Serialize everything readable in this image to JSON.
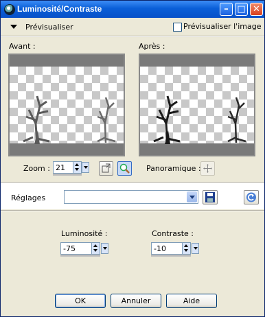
{
  "window": {
    "title": "Luminosité/Contraste",
    "controls": {
      "minimize": "–",
      "maximize": "□",
      "close": "✕"
    }
  },
  "preview_bar": {
    "label": "Prévisualiser",
    "preview_image_label": "Prévisualiser l'image",
    "preview_image_checked": false
  },
  "before_label": "Avant :",
  "after_label": "Après :",
  "zoom": {
    "label": "Zoom :",
    "value": "21"
  },
  "pan_label": "Panoramique :",
  "presets": {
    "label": "Réglages",
    "value": ""
  },
  "brightness": {
    "label": "Luminosité :",
    "value": "-75"
  },
  "contrast": {
    "label": "Contraste :",
    "value": "-10"
  },
  "buttons": {
    "ok": "OK",
    "cancel": "Annuler",
    "help": "Aide"
  },
  "colors": {
    "titlebar": "#0a5fd8",
    "dialog_bg": "#ece9d8"
  }
}
